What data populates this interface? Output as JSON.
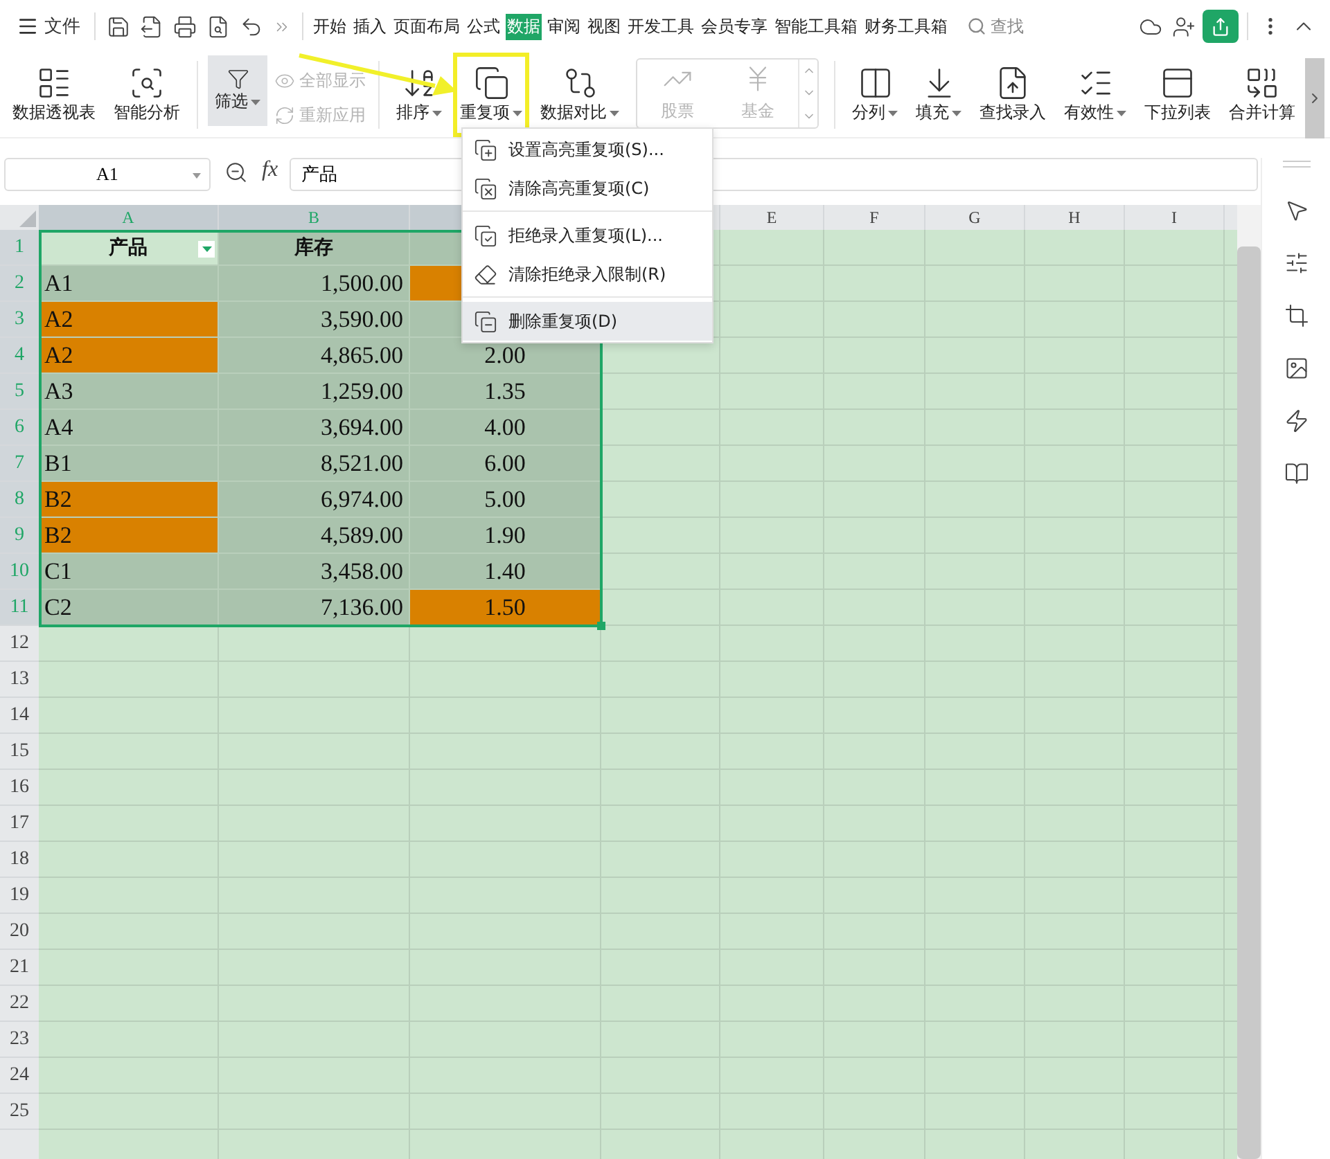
{
  "title_bar": {
    "file_menu": "文件",
    "tabs": [
      {
        "label": "开始",
        "selected": false
      },
      {
        "label": "插入",
        "selected": false
      },
      {
        "label": "页面布局",
        "selected": false
      },
      {
        "label": "公式",
        "selected": false
      },
      {
        "label": "数据",
        "selected": true
      },
      {
        "label": "审阅",
        "selected": false
      },
      {
        "label": "视图",
        "selected": false
      },
      {
        "label": "开发工具",
        "selected": false
      },
      {
        "label": "会员专享",
        "selected": false
      },
      {
        "label": "智能工具箱",
        "selected": false
      },
      {
        "label": "财务工具箱",
        "selected": false
      }
    ],
    "search": {
      "placeholder": "查找"
    }
  },
  "ribbon": {
    "items": [
      {
        "kind": "large",
        "label": "数据透视表",
        "dropdown": false,
        "pressed": false,
        "annotated": false
      },
      {
        "kind": "large",
        "label": "智能分析",
        "dropdown": false,
        "pressed": false,
        "annotated": false
      },
      {
        "kind": "divider"
      },
      {
        "kind": "large",
        "label": "筛选",
        "dropdown": true,
        "pressed": true,
        "annotated": false
      },
      {
        "kind": "small_stack",
        "entries": [
          {
            "label": "全部显示",
            "disabled": true
          },
          {
            "label": "重新应用",
            "disabled": true
          }
        ]
      },
      {
        "kind": "divider"
      },
      {
        "kind": "large",
        "label": "排序",
        "dropdown": true,
        "pressed": false,
        "annotated": false
      },
      {
        "kind": "large",
        "label": "重复项",
        "dropdown": true,
        "pressed": false,
        "annotated": true
      },
      {
        "kind": "large",
        "label": "数据对比",
        "dropdown": true,
        "pressed": false,
        "annotated": false
      },
      {
        "kind": "gallery",
        "entries": [
          {
            "label": "股票",
            "disabled": true
          },
          {
            "label": "基金",
            "disabled": true
          }
        ]
      },
      {
        "kind": "divider"
      },
      {
        "kind": "large",
        "label": "分列",
        "dropdown": true,
        "pressed": false,
        "annotated": false
      },
      {
        "kind": "large",
        "label": "填充",
        "dropdown": true,
        "pressed": false,
        "annotated": false
      },
      {
        "kind": "large",
        "label": "查找录入",
        "dropdown": false,
        "pressed": false,
        "annotated": false
      },
      {
        "kind": "large",
        "label": "有效性",
        "dropdown": true,
        "pressed": false,
        "annotated": false
      },
      {
        "kind": "large",
        "label": "下拉列表",
        "dropdown": false,
        "pressed": false,
        "annotated": false
      },
      {
        "kind": "large",
        "label": "合并计算",
        "dropdown": false,
        "pressed": false,
        "annotated": false
      }
    ]
  },
  "formula_bar": {
    "name_box": "A1",
    "function_label": "fx",
    "formula": "产品"
  },
  "dropdown_menu": {
    "groups": [
      [
        {
          "label": "设置高亮重复项(S)...",
          "selected": false
        },
        {
          "label": "清除高亮重复项(C)",
          "selected": false
        }
      ],
      [
        {
          "label": "拒绝录入重复项(L)...",
          "selected": false
        },
        {
          "label": "清除拒绝录入限制(R)",
          "selected": false
        }
      ],
      [
        {
          "label": "删除重复项(D)",
          "selected": true
        }
      ]
    ]
  },
  "sheet": {
    "columns": [
      {
        "label": "A",
        "selected": true
      },
      {
        "label": "B",
        "selected": true
      },
      {
        "selected": true
      },
      {
        "selected": false
      },
      {
        "label": "E",
        "selected": false
      },
      {
        "label": "F",
        "selected": false
      },
      {
        "label": "G",
        "selected": false
      },
      {
        "label": "H",
        "selected": false
      },
      {
        "label": "I",
        "selected": false
      }
    ],
    "rows": [
      {
        "number": "1",
        "selected": true,
        "cells": [
          {
            "text": "产品",
            "header": true,
            "filter_button": true,
            "highlighted": false
          },
          {
            "text": "库存",
            "header": true,
            "highlighted": false
          },
          {
            "highlighted": false
          }
        ]
      },
      {
        "number": "2",
        "selected": true,
        "cells": [
          {
            "text": "A1",
            "highlighted": false
          },
          {
            "text": "1,500.00",
            "highlighted": false
          },
          {
            "highlighted": true
          }
        ]
      },
      {
        "number": "3",
        "selected": true,
        "cells": [
          {
            "text": "A2",
            "highlighted": true
          },
          {
            "text": "3,590.00",
            "highlighted": false
          },
          {
            "highlighted": false
          }
        ]
      },
      {
        "number": "4",
        "selected": true,
        "cells": [
          {
            "text": "A2",
            "highlighted": true
          },
          {
            "text": "4,865.00",
            "highlighted": false
          },
          {
            "text": "2.00",
            "highlighted": false
          }
        ]
      },
      {
        "number": "5",
        "selected": true,
        "cells": [
          {
            "text": "A3",
            "highlighted": false
          },
          {
            "text": "1,259.00",
            "highlighted": false
          },
          {
            "text": "1.35",
            "highlighted": false
          }
        ]
      },
      {
        "number": "6",
        "selected": true,
        "cells": [
          {
            "text": "A4",
            "highlighted": false
          },
          {
            "text": "3,694.00",
            "highlighted": false
          },
          {
            "text": "4.00",
            "highlighted": false
          }
        ]
      },
      {
        "number": "7",
        "selected": true,
        "cells": [
          {
            "text": "B1",
            "highlighted": false
          },
          {
            "text": "8,521.00",
            "highlighted": false
          },
          {
            "text": "6.00",
            "highlighted": false
          }
        ]
      },
      {
        "number": "8",
        "selected": true,
        "cells": [
          {
            "text": "B2",
            "highlighted": true
          },
          {
            "text": "6,974.00",
            "highlighted": false
          },
          {
            "text": "5.00",
            "highlighted": false
          }
        ]
      },
      {
        "number": "9",
        "selected": true,
        "cells": [
          {
            "text": "B2",
            "highlighted": true
          },
          {
            "text": "4,589.00",
            "highlighted": false
          },
          {
            "text": "1.90",
            "highlighted": false
          }
        ]
      },
      {
        "number": "10",
        "selected": true,
        "cells": [
          {
            "text": "C1",
            "highlighted": false
          },
          {
            "text": "3,458.00",
            "highlighted": false
          },
          {
            "text": "1.40",
            "highlighted": false
          }
        ]
      },
      {
        "number": "11",
        "selected": true,
        "cells": [
          {
            "text": "C2",
            "highlighted": false
          },
          {
            "text": "7,136.00",
            "highlighted": false
          },
          {
            "text": "1.50",
            "highlighted": true
          }
        ]
      },
      {
        "number": "12",
        "selected": false,
        "cells": []
      },
      {
        "number": "13",
        "selected": false,
        "cells": []
      },
      {
        "number": "14",
        "selected": false,
        "cells": []
      },
      {
        "number": "15",
        "selected": false,
        "cells": []
      },
      {
        "number": "16",
        "selected": false,
        "cells": []
      },
      {
        "number": "17",
        "selected": false,
        "cells": []
      },
      {
        "number": "18",
        "selected": false,
        "cells": []
      },
      {
        "number": "19",
        "selected": false,
        "cells": []
      },
      {
        "number": "20",
        "selected": false,
        "cells": []
      },
      {
        "number": "21",
        "selected": false,
        "cells": []
      },
      {
        "number": "22",
        "selected": false,
        "cells": []
      },
      {
        "number": "23",
        "selected": false,
        "cells": []
      },
      {
        "number": "24",
        "selected": false,
        "cells": []
      },
      {
        "number": "25",
        "selected": false,
        "cells": []
      }
    ]
  }
}
